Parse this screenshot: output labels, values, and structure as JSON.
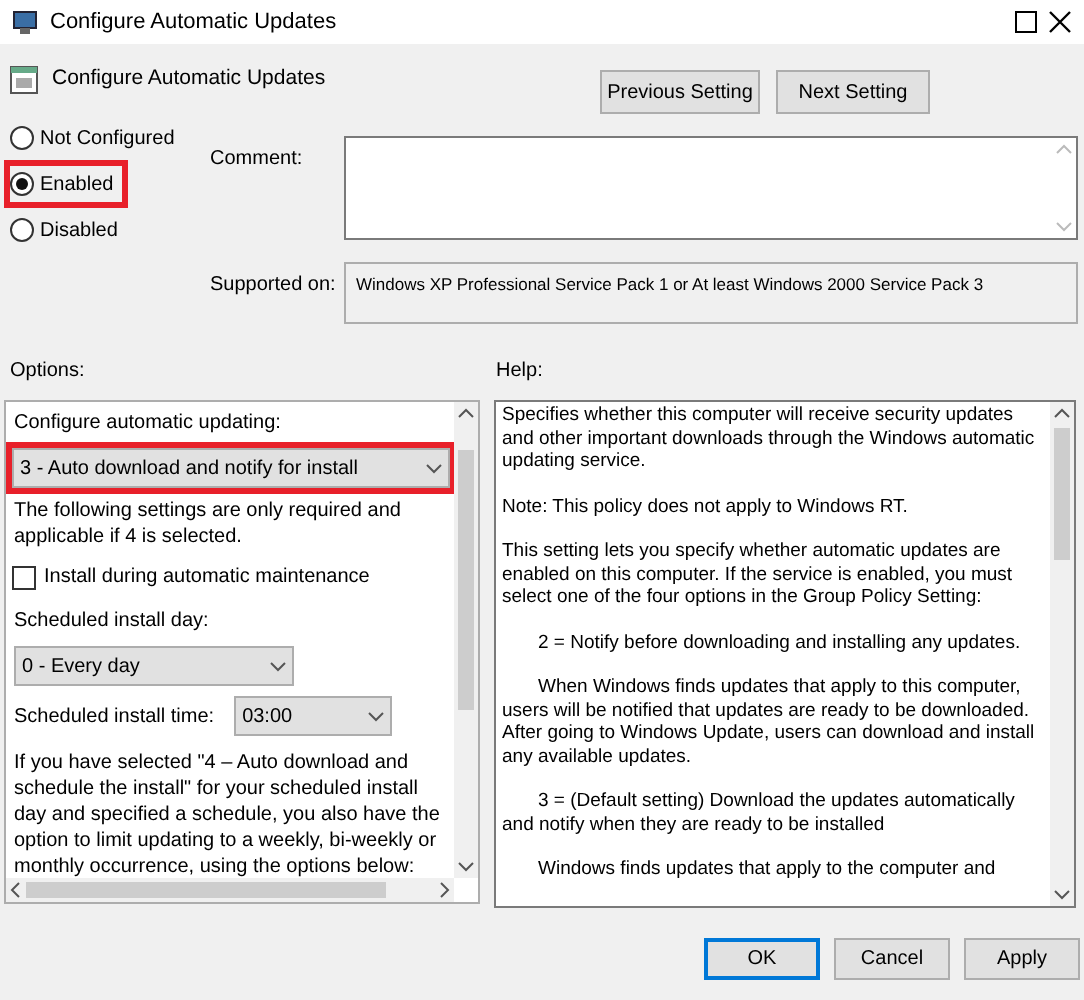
{
  "window": {
    "title": "Configure Automatic Updates"
  },
  "header": {
    "title": "Configure Automatic Updates"
  },
  "nav_buttons": [
    "Previous Setting",
    "Next Setting"
  ],
  "state_options": [
    {
      "label": "Not Configured",
      "selected": false,
      "highlighted": false
    },
    {
      "label": "Enabled",
      "selected": true,
      "highlighted": true
    },
    {
      "label": "Disabled",
      "selected": false,
      "highlighted": false
    }
  ],
  "comment": {
    "label": "Comment:"
  },
  "supported_on": {
    "label": "Supported on:",
    "value": "Windows XP Professional Service Pack 1 or At least Windows 2000 Service Pack 3"
  },
  "options": {
    "label": "Options:",
    "items": [
      {
        "kind": "text",
        "text": "Configure automatic updating:"
      },
      {
        "kind": "dropdown",
        "value": "3 - Auto download and notify for install",
        "highlighted": true
      },
      {
        "kind": "text",
        "text": "The following settings are only required and applicable if 4 is selected."
      },
      {
        "kind": "checkbox",
        "label": "Install during automatic maintenance",
        "checked": false
      },
      {
        "kind": "text",
        "text": "Scheduled install day:"
      },
      {
        "kind": "dropdown",
        "value": "0 - Every day",
        "highlighted": false
      },
      {
        "kind": "labeled_dropdown",
        "label": "Scheduled install time:",
        "value": "03:00"
      },
      {
        "kind": "text",
        "text": "If you have selected \"4 – Auto download and schedule the install\" for your scheduled install day and specified a schedule, you also have the option to limit updating to a weekly, bi-weekly or monthly occurrence, using the options below:"
      }
    ]
  },
  "help": {
    "label": "Help:",
    "paragraphs": [
      {
        "text": "Specifies whether this computer will receive security updates and other important downloads through the Windows automatic updating service.",
        "indent": false
      },
      {
        "text": "Note: This policy does not apply to Windows RT.",
        "indent": false
      },
      {
        "text": "This setting lets you specify whether automatic updates are enabled on this computer. If the service is enabled, you must select one of the four options in the Group Policy Setting:",
        "indent": false
      },
      {
        "text": "2 = Notify before downloading and installing any updates.",
        "indent": true
      },
      {
        "text": "When Windows finds updates that apply to this computer, users will be notified that updates are ready to be downloaded. After going to Windows Update, users can download and install any available updates.",
        "indent": true
      },
      {
        "text": "3 = (Default setting) Download the updates automatically and notify when they are ready to be installed",
        "indent": true
      },
      {
        "text": "Windows finds updates that apply to the computer and",
        "indent": true
      }
    ]
  },
  "footer_buttons": [
    {
      "label": "OK",
      "selected": true
    },
    {
      "label": "Cancel",
      "selected": false
    },
    {
      "label": "Apply",
      "selected": false
    }
  ]
}
